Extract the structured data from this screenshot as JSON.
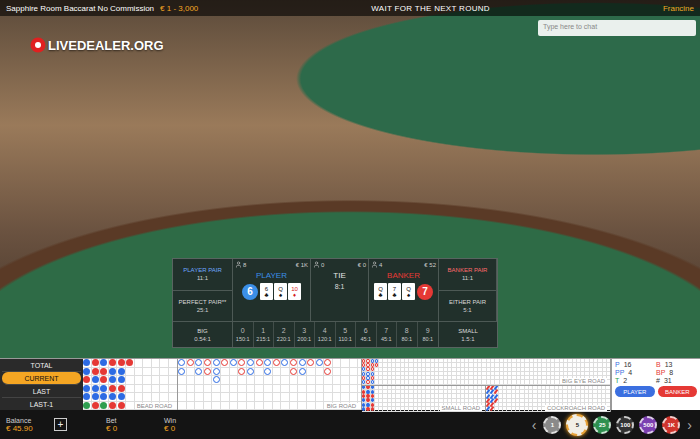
{
  "top_bar": {
    "table_name": "Sapphire Room Baccarat No Commission",
    "limits": "€ 1 - 3,000",
    "status": "WAIT FOR THE NEXT ROUND",
    "dealer": "Francine"
  },
  "watermark": "LIVEDEALER.ORG",
  "chat": {
    "placeholder": "Type here to chat"
  },
  "side_bets_left": [
    {
      "label": "PLAYER PAIR",
      "payout": "11:1",
      "color": "#6fa8ff"
    },
    {
      "label": "PERFECT PAIR**",
      "payout": "25:1",
      "color": "#d8d8d8"
    }
  ],
  "side_bets_right": [
    {
      "label": "BANKER PAIR",
      "payout": "11:1",
      "color": "#ff6b6b"
    },
    {
      "label": "EITHER PAIR",
      "payout": "5:1",
      "color": "#d8d8d8"
    }
  ],
  "main_bets": [
    {
      "kind": "hand",
      "label": "PLAYER",
      "players": "8",
      "amount": "€ 1K",
      "score": "6",
      "color": "#3b8fe8",
      "cards": [
        {
          "rank": "6",
          "suit": "♣",
          "color": "#111111"
        },
        {
          "rank": "Q",
          "suit": "♠",
          "color": "#111111"
        },
        {
          "rank": "10",
          "suit": "♦",
          "color": "#d42020"
        }
      ]
    },
    {
      "kind": "tie",
      "label": "TIE",
      "players": "0",
      "amount": "€ 0",
      "payout": "8:1",
      "color": "#e6e6e6"
    },
    {
      "kind": "hand",
      "label": "BANKER",
      "players": "4",
      "amount": "€ 52",
      "score": "7",
      "color": "#e53935",
      "cards": [
        {
          "rank": "Q",
          "suit": "♣",
          "color": "#111111"
        },
        {
          "rank": "7",
          "suit": "♣",
          "color": "#111111"
        },
        {
          "rank": "Q",
          "suit": "♠",
          "color": "#111111"
        }
      ]
    }
  ],
  "big": {
    "label": "BIG",
    "payout": "0.54:1"
  },
  "small": {
    "label": "SMALL",
    "payout": "1.5:1"
  },
  "number_bets": [
    {
      "label": "0",
      "payout": "150:1"
    },
    {
      "label": "1",
      "payout": "215:1"
    },
    {
      "label": "2",
      "payout": "220:1"
    },
    {
      "label": "3",
      "payout": "200:1"
    },
    {
      "label": "4",
      "payout": "120:1"
    },
    {
      "label": "5",
      "payout": "110:1"
    },
    {
      "label": "6",
      "payout": "45:1"
    },
    {
      "label": "7",
      "payout": "45:1"
    },
    {
      "label": "8",
      "payout": "80:1"
    },
    {
      "label": "9",
      "payout": "80:1"
    }
  ],
  "history_tabs": [
    {
      "label": "TOTAL",
      "selected": false
    },
    {
      "label": "CURRENT",
      "selected": true
    },
    {
      "label": "LAST",
      "selected": false
    },
    {
      "label": "LAST-1",
      "selected": false
    }
  ],
  "bead_road": {
    "label": "BEAD ROAD",
    "results": [
      "P",
      "P",
      "B",
      "P",
      "P",
      "T",
      "B",
      "B",
      "P",
      "P",
      "P",
      "B",
      "P",
      "B",
      "B",
      "P",
      "P",
      "T",
      "B",
      "P",
      "P",
      "B",
      "P",
      "B",
      "B",
      "P",
      "P",
      "B",
      "P",
      "B",
      "B"
    ]
  },
  "big_road": {
    "label": "BIG ROAD"
  },
  "big_eye_road": {
    "label": "BIG EYE ROAD",
    "marks": [
      "r",
      "r",
      "b",
      "b",
      "r",
      "b",
      "r",
      "r",
      "r",
      "b",
      "b",
      "r",
      "b",
      "r",
      "r",
      "b",
      "r",
      "b",
      "b",
      "r"
    ]
  },
  "small_road": {
    "label": "SMALL ROAD",
    "marks": [
      "b",
      "r",
      "r",
      "b",
      "b",
      "b",
      "r",
      "b",
      "r",
      "r",
      "b",
      "r",
      "b",
      "b",
      "r",
      "b",
      "r",
      "r"
    ]
  },
  "cockroach_road": {
    "label": "COCKROACH ROAD",
    "marks": [
      "r",
      "b",
      "b",
      "r",
      "r",
      "b",
      "r",
      "b",
      "b",
      "b",
      "r",
      "r",
      "b",
      "r",
      "b",
      "r"
    ]
  },
  "stats": [
    {
      "label": "P",
      "value": "16",
      "color": "#3b6fe0"
    },
    {
      "label": "B",
      "value": "13",
      "color": "#e53935"
    },
    {
      "label": "PP",
      "value": "4",
      "color": "#3b6fe0"
    },
    {
      "label": "BP",
      "value": "8",
      "color": "#e53935"
    },
    {
      "label": "T",
      "value": "2",
      "color": "#2e9e4f"
    },
    {
      "label": "#",
      "value": "31",
      "color": "#333333"
    }
  ],
  "predict_buttons": [
    {
      "label": "PLAYER",
      "color": "#3b6fe0"
    },
    {
      "label": "BANKER",
      "color": "#e53935"
    }
  ],
  "balance": {
    "label": "Balance",
    "value": "€ 45.90",
    "add": "+"
  },
  "bet": {
    "label": "Bet",
    "value": "€ 0"
  },
  "win": {
    "label": "Win",
    "value": "€ 0"
  },
  "chips": {
    "prev": "‹",
    "next": "›",
    "items": [
      {
        "label": "1",
        "color": "#8a8a8a",
        "selected": false
      },
      {
        "label": "5",
        "color": "#f2efe6",
        "selected": true
      },
      {
        "label": "25",
        "color": "#2f8f4f",
        "selected": false
      },
      {
        "label": "100",
        "color": "#333333",
        "selected": false
      },
      {
        "label": "500",
        "color": "#7b3fb0",
        "selected": false
      },
      {
        "label": "1K",
        "color": "#d0342c",
        "selected": false
      }
    ]
  }
}
